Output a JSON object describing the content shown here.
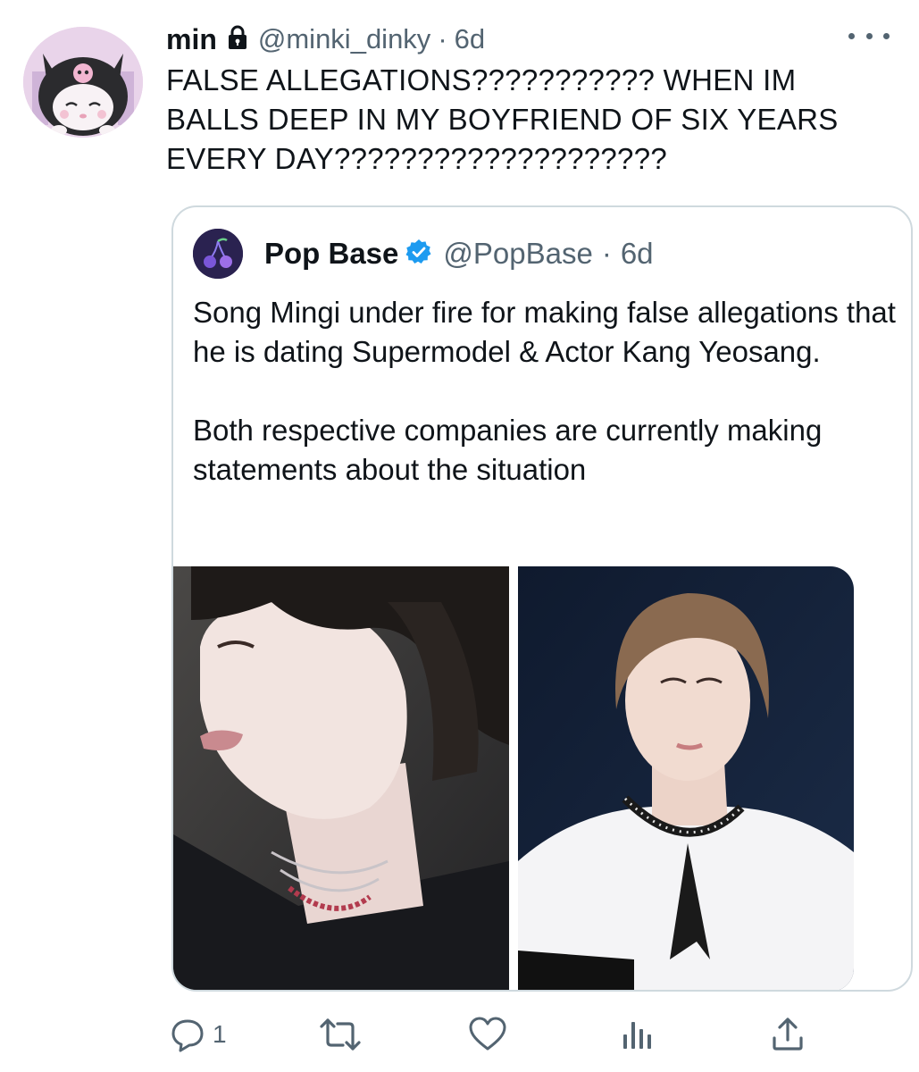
{
  "author": {
    "display_name": "min",
    "handle": "@minki_dinky",
    "separator": "·",
    "time": "6d",
    "avatar_icon": "kuromi-avatar-icon",
    "protected_icon": "lock-icon"
  },
  "tweet": {
    "text": "FALSE ALLEGATIONS??????????? WHEN IM BALLS DEEP IN MY BOYFRIEND OF SIX YEARS EVERY DAY????????????????????"
  },
  "quoted": {
    "display_name": "Pop Base",
    "handle": "@PopBase",
    "separator": "·",
    "time": "6d",
    "verified_icon": "verified-badge-icon",
    "paragraph_1": "Song Mingi under fire for making false allegations that he is dating Supermodel & Actor Kang Yeosang.",
    "paragraph_2": "Both respective companies are currently making statements about the situation",
    "media": [
      "photo-left",
      "photo-right"
    ]
  },
  "actions": {
    "reply_count": "1",
    "retweet_count": "",
    "like_count": "",
    "icons": [
      "reply-icon",
      "retweet-icon",
      "like-icon",
      "analytics-icon",
      "share-icon"
    ]
  },
  "colors": {
    "text": "#0f1419",
    "secondary": "#536471",
    "border": "#cfd9de",
    "verified": "#1d9bf0"
  }
}
